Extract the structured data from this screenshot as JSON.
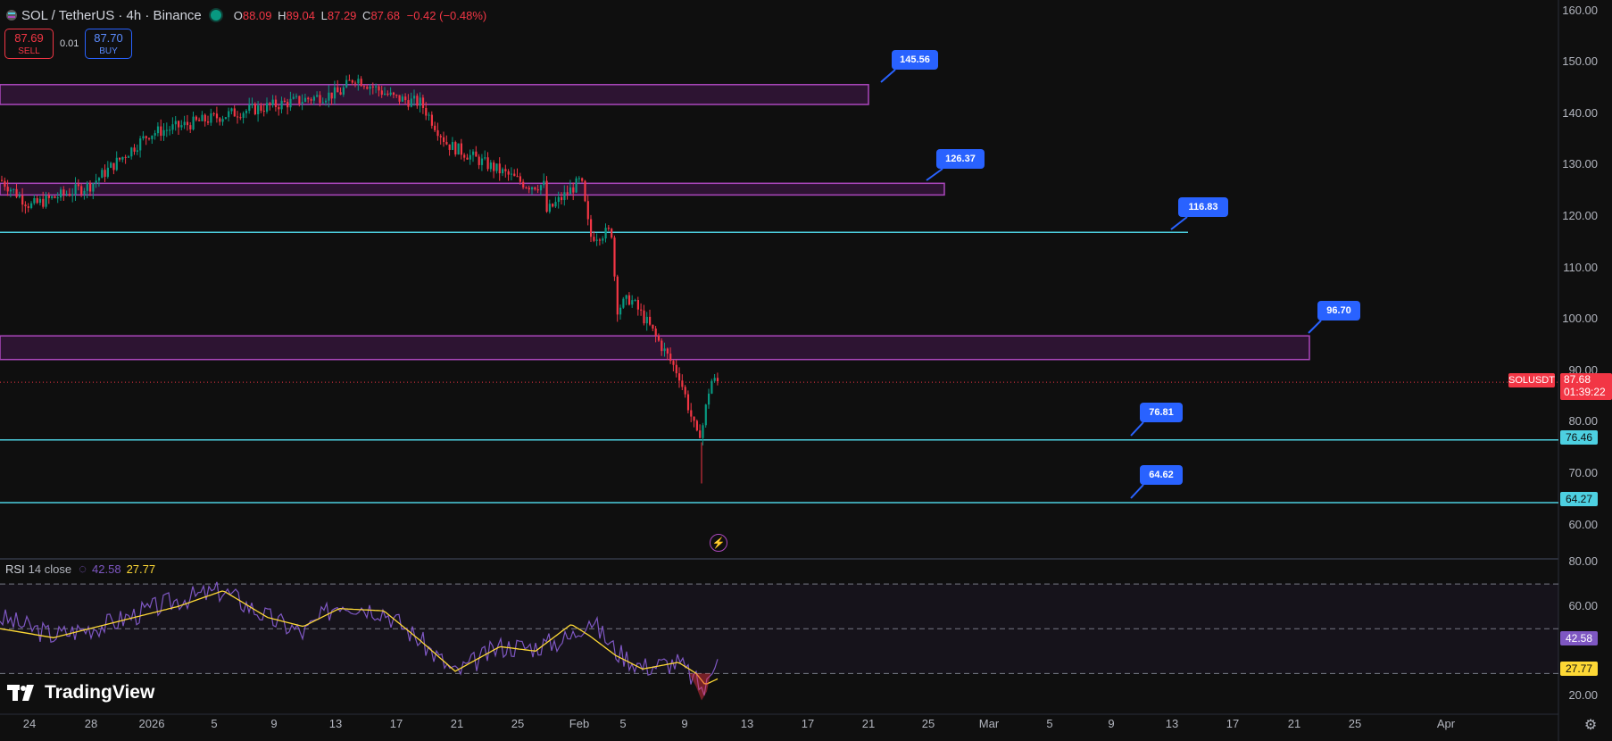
{
  "header": {
    "symbol": "SOL / TetherUS · 4h · Binance",
    "open_k": "O",
    "open_v": "88.09",
    "high_k": "H",
    "high_v": "89.04",
    "low_k": "L",
    "low_v": "87.29",
    "close_k": "C",
    "close_v": "87.68",
    "change": "−0.42 (−0.48%)"
  },
  "trade": {
    "sell_price": "87.69",
    "sell_label": "SELL",
    "buy_price": "87.70",
    "buy_label": "BUY",
    "spread": "0.01"
  },
  "price_axis": [
    "160.00",
    "150.00",
    "140.00",
    "130.00",
    "120.00",
    "110.00",
    "100.00",
    "90.00",
    "80.00",
    "70.00",
    "60.00"
  ],
  "rsi_axis": [
    "80.00",
    "60.00",
    "20.00"
  ],
  "symbol_tag": {
    "name": "SOLUSDT",
    "price": "87.68",
    "countdown": "01:39:22"
  },
  "level_tags": {
    "upper": "76.46",
    "lower": "64.27"
  },
  "rsi_tags": {
    "rsi": "42.58",
    "ma": "27.77"
  },
  "callouts": [
    {
      "label": "145.56"
    },
    {
      "label": "126.37"
    },
    {
      "label": "116.83"
    },
    {
      "label": "96.70"
    },
    {
      "label": "76.81"
    },
    {
      "label": "64.62"
    }
  ],
  "date_axis": [
    "24",
    "28",
    "2026",
    "5",
    "9",
    "13",
    "17",
    "21",
    "25",
    "Feb",
    "5",
    "9",
    "13",
    "17",
    "21",
    "25",
    "Mar",
    "5",
    "9",
    "13",
    "17",
    "21",
    "25",
    "Apr"
  ],
  "rsi_indicator": {
    "name": "RSI",
    "params": "14 close",
    "value": "42.58",
    "ma_value": "27.77"
  },
  "logo": {
    "text": "TradingView"
  },
  "colors": {
    "up": "#089981",
    "down": "#f23645",
    "zone": "#9c27b0",
    "line": "#4dd0e1",
    "callout": "#2962ff",
    "rsi": "#7e57c2",
    "rsi_ma": "#fdd835"
  },
  "chart_data": {
    "type": "candlestick",
    "symbol": "SOLUSDT",
    "timeframe": "4h",
    "ylim": [
      55,
      162
    ],
    "current_price": 87.68,
    "zones": [
      {
        "low": 141.7,
        "high": 145.56
      },
      {
        "low": 124.1,
        "high": 126.37
      },
      {
        "low": 92.1,
        "high": 96.7
      }
    ],
    "lines": [
      116.83,
      76.46,
      64.27
    ],
    "price_path": [
      [
        "24",
        127
      ],
      [
        "28",
        122
      ],
      [
        "2026",
        126
      ],
      [
        "5",
        136
      ],
      [
        "9",
        140
      ],
      [
        "13",
        144
      ],
      [
        "14",
        147
      ],
      [
        "17",
        143
      ],
      [
        "18",
        142
      ],
      [
        "19",
        134
      ],
      [
        "21",
        126
      ],
      [
        "25",
        126
      ],
      [
        "26",
        119
      ],
      [
        "28",
        127
      ],
      [
        "30",
        116
      ],
      [
        "31",
        117
      ],
      [
        "Feb",
        102
      ],
      [
        "2",
        104
      ],
      [
        "3",
        99
      ],
      [
        "4",
        89
      ],
      [
        "5",
        77
      ],
      [
        "5.5",
        79
      ],
      [
        "6",
        88
      ],
      [
        "6.3",
        87.68
      ]
    ],
    "rsi": {
      "period": 14,
      "source": "close",
      "levels": [
        70,
        50,
        30
      ],
      "ylim": [
        15,
        80
      ],
      "value": 42.58,
      "ma": 27.77
    }
  }
}
